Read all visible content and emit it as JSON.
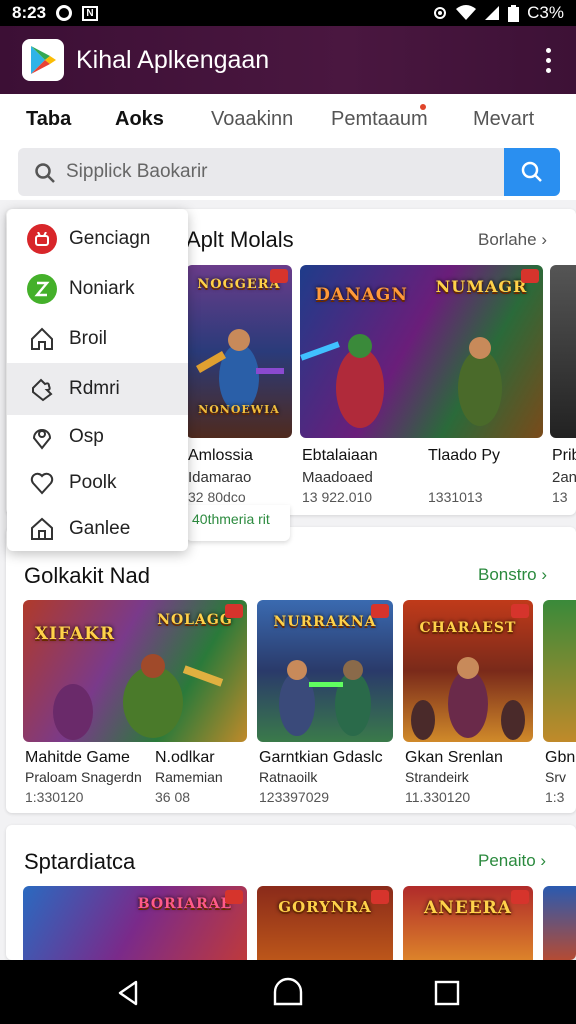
{
  "status": {
    "time": "8:23",
    "battery": "C3%"
  },
  "app": {
    "title": "Kihal Aplkengaan"
  },
  "tabs": [
    {
      "label": "Taba"
    },
    {
      "label": "Aoks"
    },
    {
      "label": "Voaakinn"
    },
    {
      "label": "Pemtaaum"
    },
    {
      "label": "Mevart"
    }
  ],
  "search": {
    "placeholder": "Sipplick Baokarir"
  },
  "menu": {
    "items": [
      {
        "label": "Genciagn",
        "icon": "red-badge-icon"
      },
      {
        "label": "Noniark",
        "icon": "green-badge-icon"
      },
      {
        "label": "Broil",
        "icon": "home-icon"
      },
      {
        "label": "Rdmri",
        "icon": "puzzle-icon"
      },
      {
        "label": "Osp",
        "icon": "pin-icon"
      },
      {
        "label": "Poolk",
        "icon": "heart-icon"
      },
      {
        "label": "Ganlee",
        "icon": "house-icon"
      }
    ]
  },
  "section1": {
    "title": "Aplt Molals",
    "link": "Borlahe",
    "promo": "40thmeria rit",
    "cards": [
      {
        "art": "NOGGERA",
        "bottom_art": "NONOEWIA",
        "name": "Amlossia",
        "sub": "Idamarao",
        "num": "32 80dco"
      },
      {
        "art": "DANAGN",
        "name": "Ebtalaiaan",
        "sub": "Maadoaed",
        "num": "13 922.010"
      },
      {
        "art": "NUMAGR",
        "name": "Tlaado Py",
        "sub": "",
        "num": "1331013"
      },
      {
        "art": "",
        "name": "Prib",
        "sub": "2an",
        "num": "13"
      }
    ]
  },
  "section2": {
    "title": "Golkakit Nad",
    "link": "Bonstro",
    "cards": [
      {
        "art": "XIFAKR",
        "art2": "NOLAGG",
        "name": "Mahitde Game",
        "name2": "N.odlkar",
        "sub": "Praloam Snagerdn",
        "sub2": "Ramemian",
        "num": "1:330120",
        "num2": "36 08"
      },
      {
        "art": "NURRAKNA",
        "name": "Garntkian Gdaslc",
        "sub": "Ratnaoilk",
        "num": "123397029"
      },
      {
        "art": "CHARAEST",
        "name": "Gkan Srenlan",
        "sub": "Strandeirk",
        "num": "11.330120"
      },
      {
        "art": "",
        "name": "Gbn",
        "sub": "Srv",
        "num": "1:3"
      }
    ]
  },
  "section3": {
    "title": "Sptardiatca",
    "link": "Penaito",
    "cards": [
      {
        "art": "BORIARAE"
      },
      {
        "art": "GORYNRA"
      },
      {
        "art": "ANEERA"
      },
      {
        "art": ""
      }
    ]
  },
  "colors": {
    "appbar": "#4a1740",
    "accent_green": "#2b8a3e",
    "search_button": "#2a8ff0"
  }
}
